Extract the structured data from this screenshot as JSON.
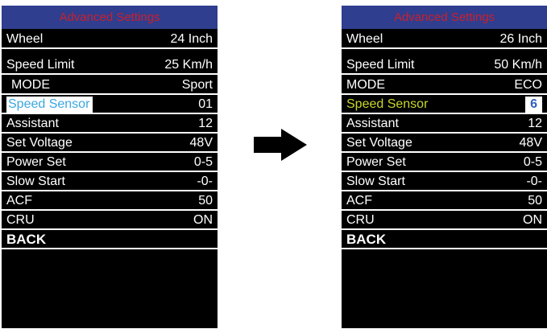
{
  "left_panel": {
    "title": "Advanced Settings",
    "rows": [
      {
        "label": "Wheel",
        "value": "24 Inch"
      },
      {
        "label": "Speed Limit",
        "value": "25 Km/h"
      },
      {
        "label": "MODE",
        "value": "Sport"
      },
      {
        "label": "Speed Sensor",
        "value": "01"
      },
      {
        "label": "Assistant",
        "value": "12"
      },
      {
        "label": "Set Voltage",
        "value": "48V"
      },
      {
        "label": "Power Set",
        "value": "0-5"
      },
      {
        "label": "Slow Start",
        "value": "-0-"
      },
      {
        "label": "ACF",
        "value": "50"
      },
      {
        "label": "CRU",
        "value": "ON"
      }
    ],
    "back_label": "BACK"
  },
  "right_panel": {
    "title": "Advanced Settings",
    "rows": [
      {
        "label": "Wheel",
        "value": "26 Inch"
      },
      {
        "label": "Speed Limit",
        "value": "50 Km/h"
      },
      {
        "label": "MODE",
        "value": "ECO"
      },
      {
        "label": "Speed Sensor",
        "value": "6"
      },
      {
        "label": "Assistant",
        "value": "12"
      },
      {
        "label": "Set Voltage",
        "value": "48V"
      },
      {
        "label": "Power Set",
        "value": "0-5"
      },
      {
        "label": "Slow Start",
        "value": "-0-"
      },
      {
        "label": "ACF",
        "value": "50"
      },
      {
        "label": "CRU",
        "value": "ON"
      }
    ],
    "back_label": "BACK"
  },
  "arrow_icon": "right-arrow-icon",
  "colors": {
    "header_bg": "#2f3e8e",
    "header_text": "#c8202e",
    "selected_blue": "#3aa6e0",
    "selected_green": "#c8d82a",
    "value_box_text": "#2f5fbf"
  }
}
